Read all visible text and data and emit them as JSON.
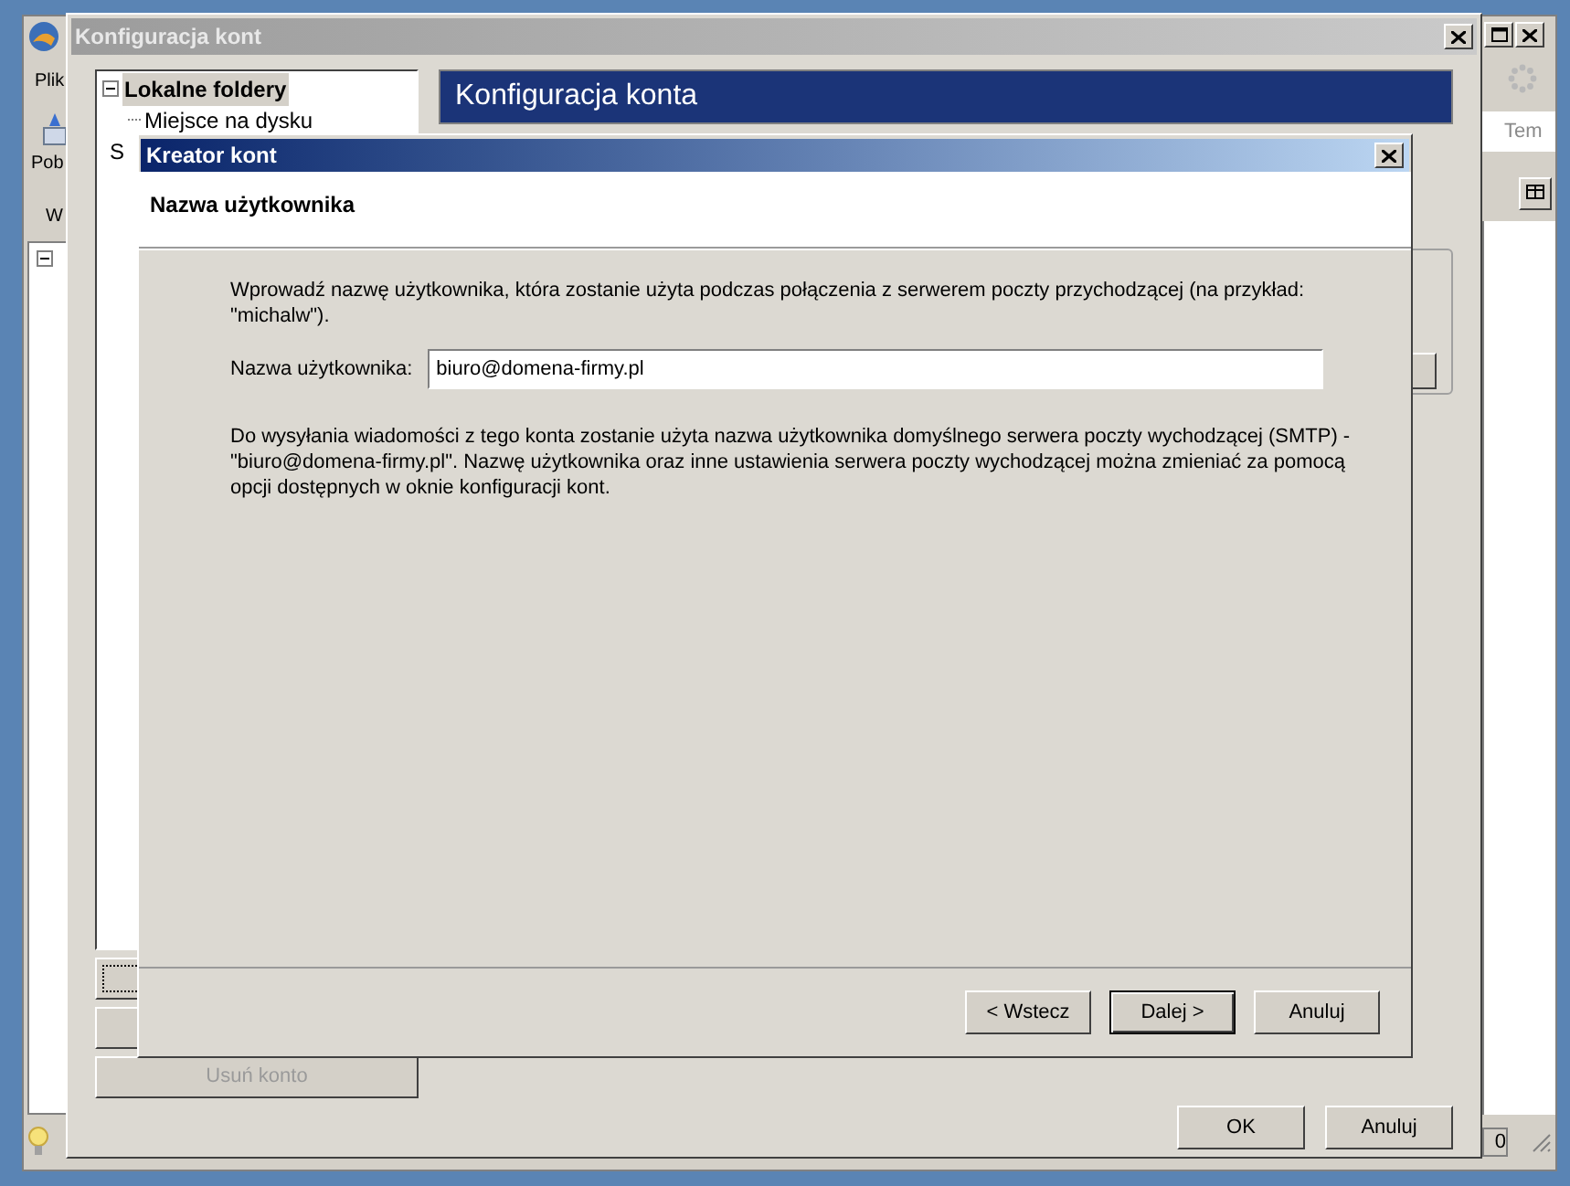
{
  "main_window": {
    "menu": [
      "Plik"
    ],
    "toolbar_button": "Pob",
    "column_label": "W",
    "search_placeholder": "Tem",
    "status_text": "0"
  },
  "config_dialog": {
    "title": "Konfiguracja kont",
    "tree": [
      {
        "label": "Lokalne foldery",
        "selected": true,
        "expanded": true,
        "children": [
          {
            "label": "Miejsce na dysku",
            "selected": false
          }
        ]
      },
      {
        "label": "S",
        "selected": false
      }
    ],
    "header": "Konfiguracja konta",
    "side_buttons": [
      {
        "focused": true
      },
      {
        "focused": false
      },
      {
        "label": "Usuń konto",
        "focused": false,
        "disabled": true
      }
    ],
    "buttons": [
      "OK",
      "Anuluj"
    ]
  },
  "wizard": {
    "title": "Kreator kont",
    "page_title": "Nazwa użytkownika",
    "intro": "Wprowadź nazwę użytkownika, która zostanie użyta podczas połączenia z serwerem poczty przychodzącej (na przykład: \"michalw\").",
    "field": {
      "label": "Nazwa użytkownika:",
      "value": "biuro@domena-firmy.pl"
    },
    "note": "Do wysyłania wiadomości z tego konta zostanie użyta nazwa użytkownika domyślnego serwera poczty wychodzącej (SMTP) - \"biuro@domena-firmy.pl\". Nazwę użytkownika oraz inne ustawienia serwera poczty wychodzącej można zmieniać za pomocą opcji dostępnych w oknie konfiguracji kont.",
    "buttons": [
      {
        "label": "< Wstecz",
        "default": false
      },
      {
        "label": "Dalej >",
        "default": true
      },
      {
        "label": "Anuluj",
        "default": false
      }
    ]
  }
}
